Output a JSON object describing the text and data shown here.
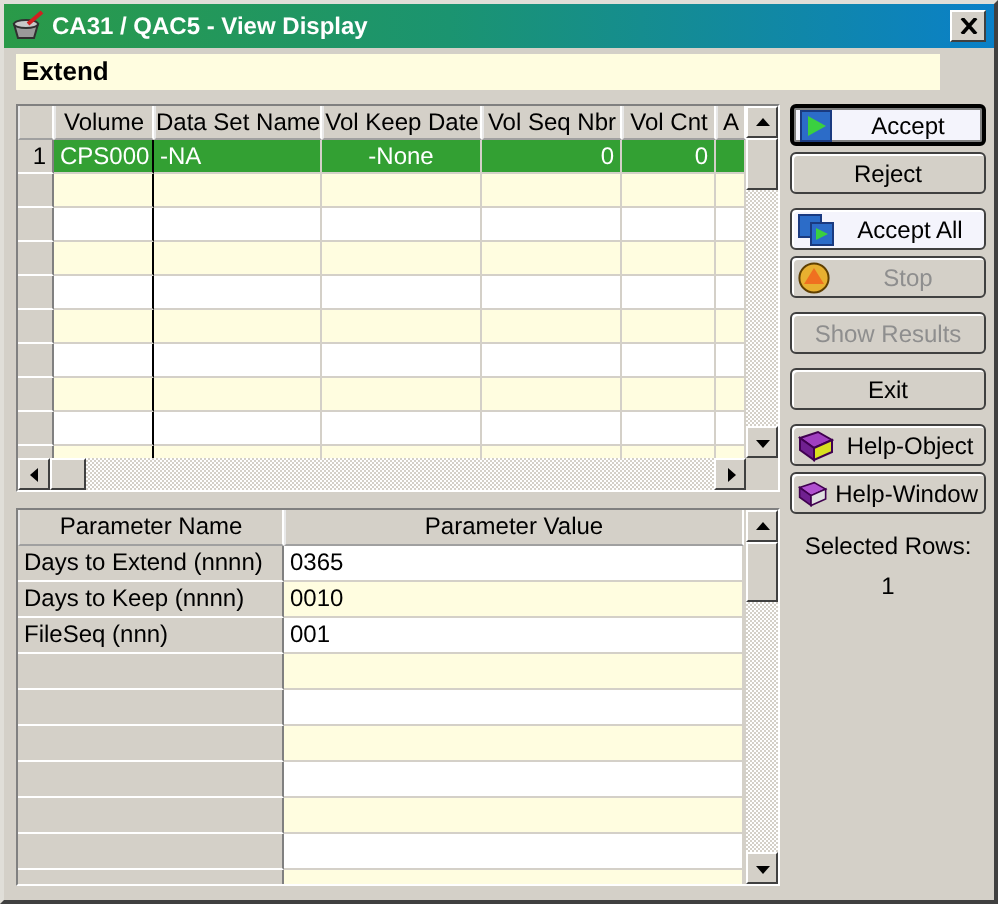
{
  "window": {
    "title": "CA31 / QAC5 - View Display"
  },
  "header": {
    "title": "Extend"
  },
  "volume_table": {
    "columns": [
      "Volume",
      "Data Set Name",
      "Vol Keep Date",
      "Vol Seq Nbr",
      "Vol Cnt",
      "A"
    ],
    "rows": [
      {
        "number": "1",
        "cells": [
          "CPS000",
          "-NA",
          "-None",
          "0",
          "0"
        ],
        "selected": true
      }
    ]
  },
  "parameter_table": {
    "columns": [
      "Parameter Name",
      "Parameter Value"
    ],
    "rows": [
      {
        "name": "Days to Extend (nnnn)",
        "value": "0365"
      },
      {
        "name": "Days to Keep (nnnn)",
        "value": "0010"
      },
      {
        "name": "FileSeq (nnn)",
        "value": "001"
      }
    ]
  },
  "buttons": [
    {
      "label": "Accept",
      "highlighted": true,
      "focused": true,
      "disabled": false
    },
    {
      "label": "Reject",
      "highlighted": false,
      "focused": false,
      "disabled": false
    },
    {
      "label": "Accept All",
      "highlighted": true,
      "focused": false,
      "disabled": false
    },
    {
      "label": "Stop",
      "highlighted": false,
      "focused": false,
      "disabled": true
    },
    {
      "label": "Show Results",
      "highlighted": false,
      "focused": false,
      "disabled": true
    },
    {
      "label": "Exit",
      "highlighted": false,
      "focused": false,
      "disabled": false
    },
    {
      "label": "Help-Object",
      "highlighted": false,
      "focused": false,
      "disabled": false
    },
    {
      "label": "Help-Window",
      "highlighted": false,
      "focused": false,
      "disabled": false
    }
  ],
  "selected_rows": {
    "label": "Selected Rows:",
    "value": "1"
  }
}
